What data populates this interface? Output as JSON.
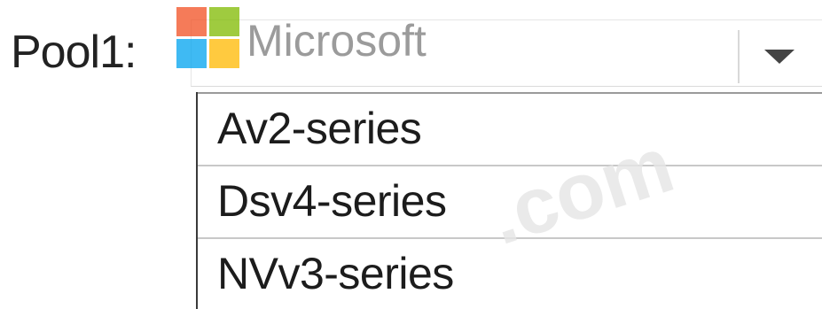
{
  "field": {
    "label": "Pool1:"
  },
  "logo": {
    "text": "Microsoft",
    "colors": [
      "#f25022",
      "#7fba00",
      "#00a4ef",
      "#ffb900"
    ]
  },
  "dropdown": {
    "selected": "",
    "arrow_icon": "triangle-down-icon",
    "options": [
      {
        "label": "Av2-series"
      },
      {
        "label": "Dsv4-series"
      },
      {
        "label": "NVv3-series"
      }
    ]
  },
  "watermark": {
    "text": ".com"
  }
}
